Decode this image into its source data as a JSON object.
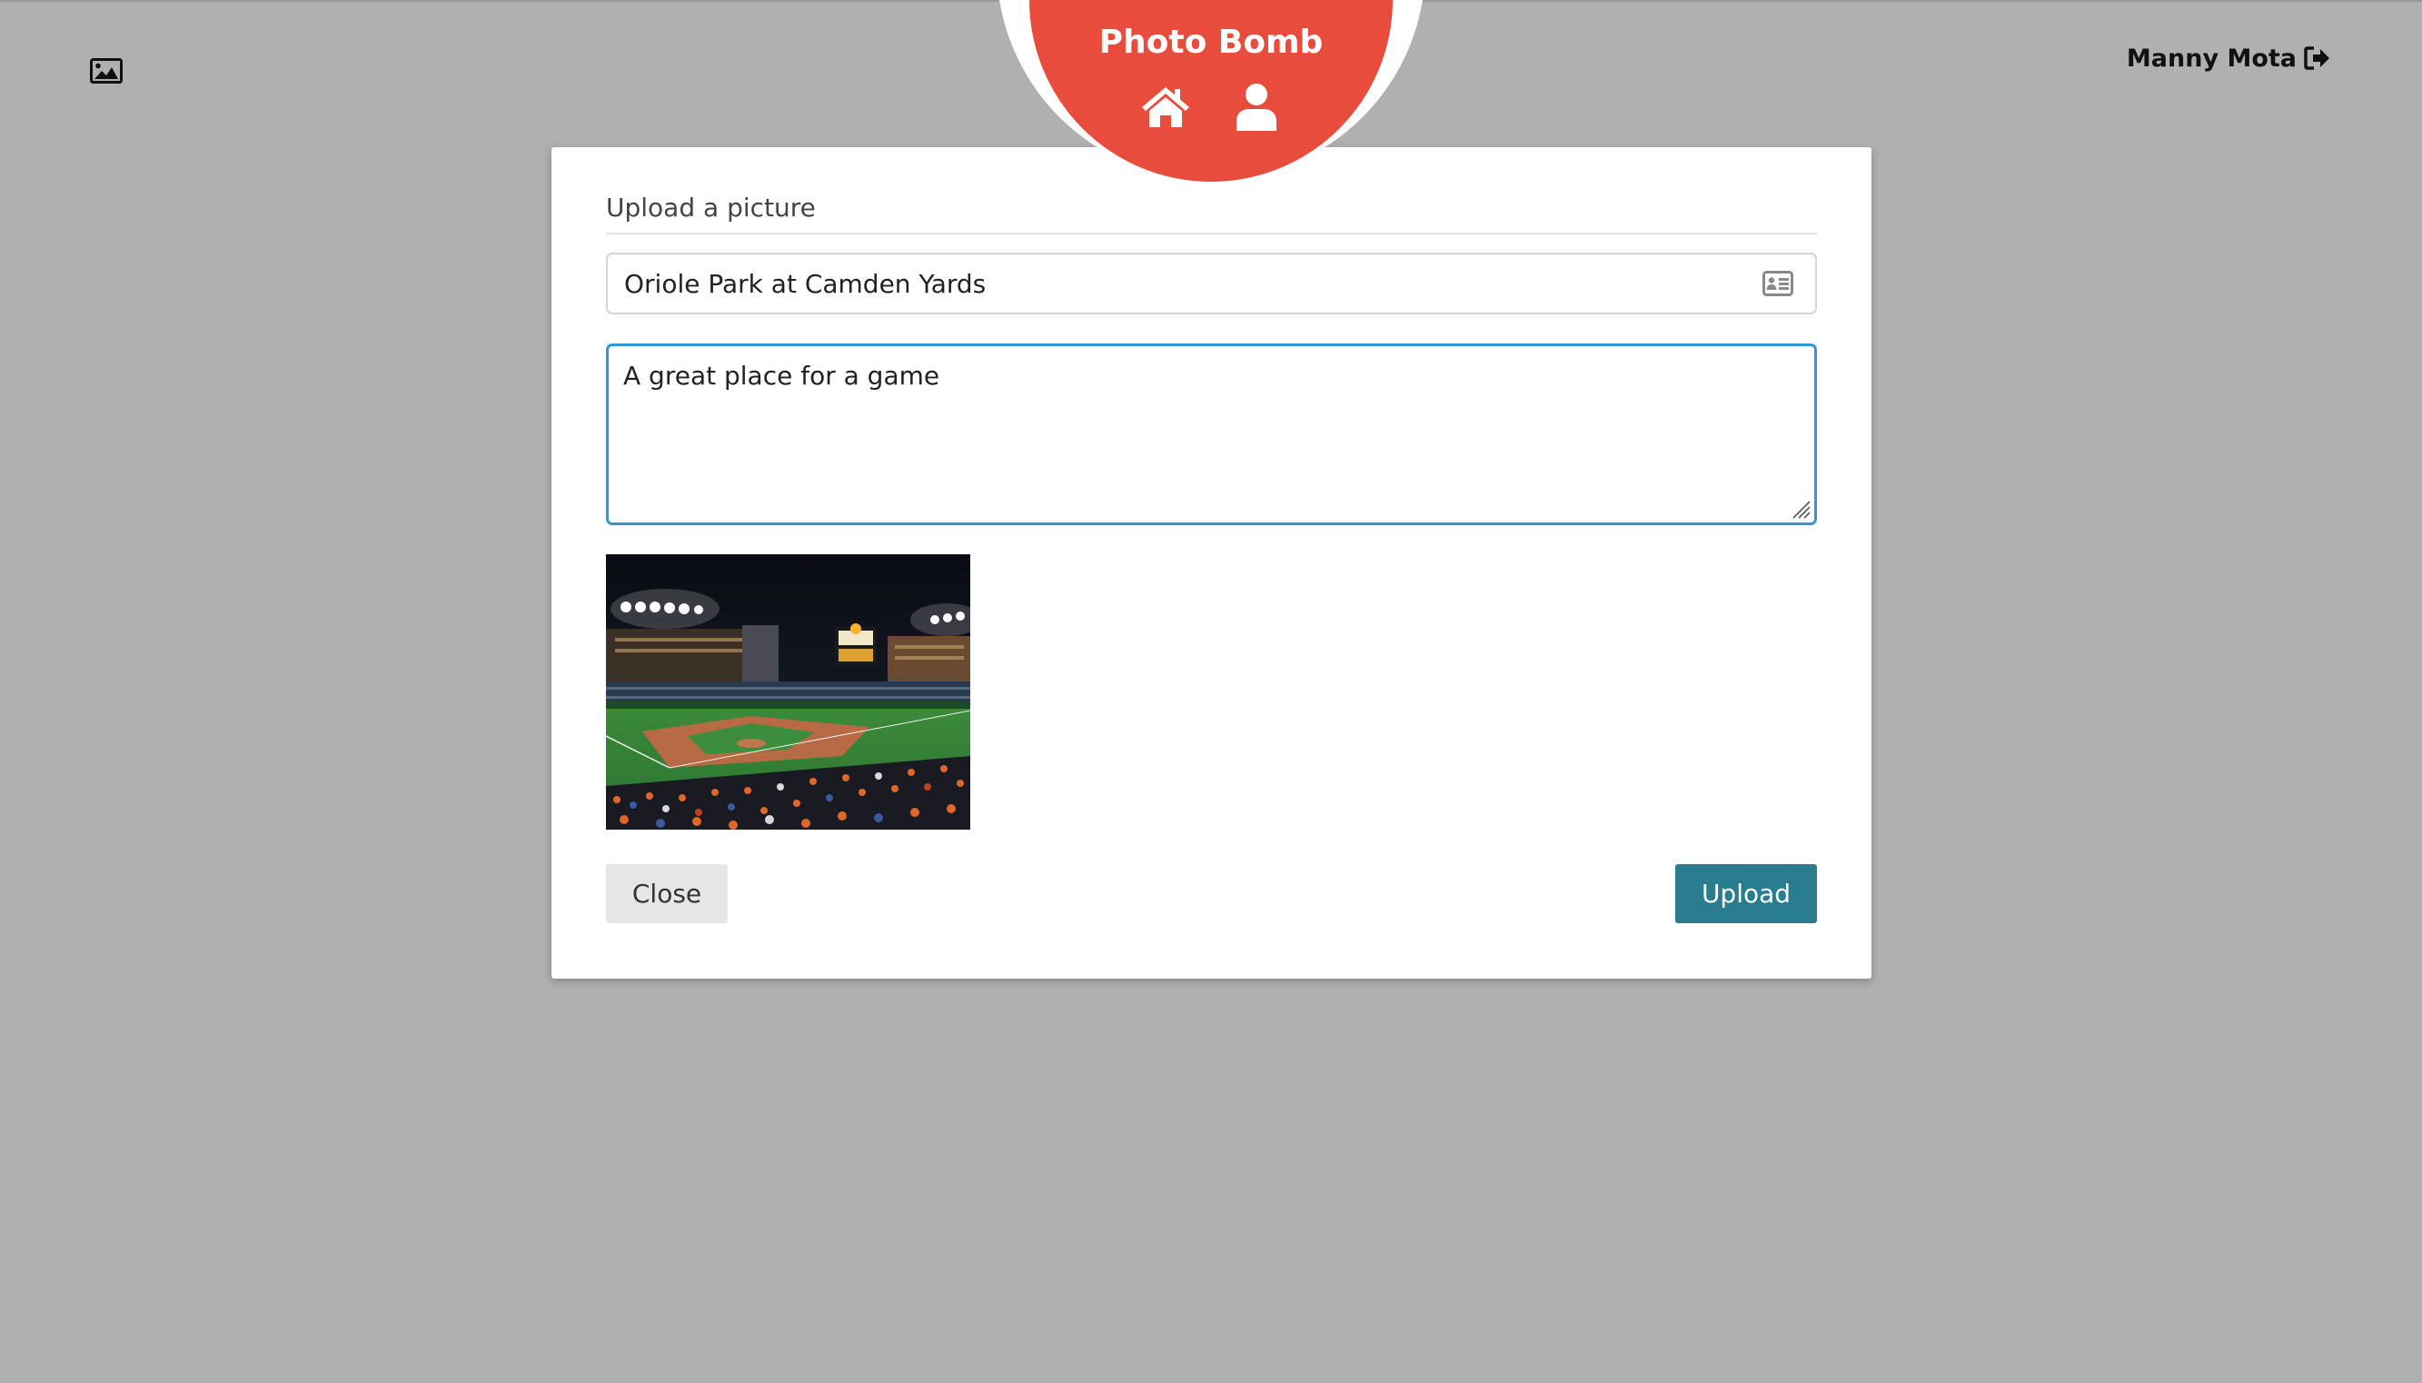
{
  "app": {
    "brand": "Photo Bomb",
    "brand_color": "#e84c3d",
    "nav": [
      {
        "icon": "home-icon"
      },
      {
        "icon": "user-icon"
      }
    ],
    "gallery_icon": "image-icon",
    "user": {
      "name": "Manny Mota",
      "icon": "sign-out-icon"
    }
  },
  "modal": {
    "title": "Upload a picture",
    "title_field": {
      "value": "Oriole Park at Camden Yards",
      "icon": "id-card-icon"
    },
    "description_field": {
      "value": "A great place for a game"
    },
    "preview": {
      "icon": "photo-preview"
    },
    "close_label": "Close",
    "upload_label": "Upload",
    "upload_color": "#2a7d8f"
  }
}
